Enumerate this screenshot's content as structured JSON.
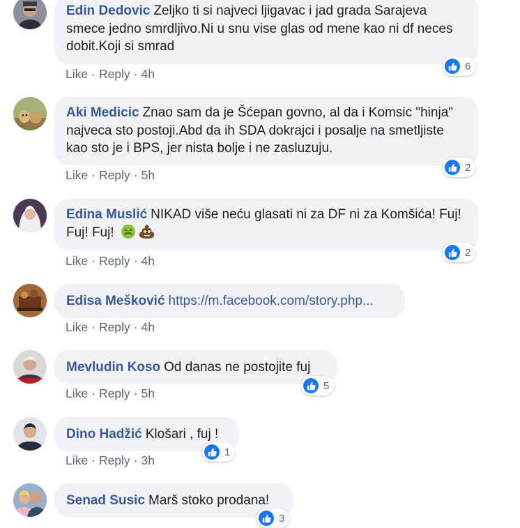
{
  "actions": {
    "like": "Like",
    "reply": "Reply"
  },
  "comments": [
    {
      "author": "Edin Dedovic",
      "text": "Zeljko ti si najveci ljigavac i jad grada Sarajeva smece jedno smrdljivo.Ni u snu vise glas od mene kao ni df neces dobit.Koji si smrad",
      "time": "4h",
      "likes": "6"
    },
    {
      "author": "Aki Medicic",
      "text": "Znao sam da je Šćepan govno, al da i Komsic \"hinja\" najveca sto postoji.Abd da ih SDA dokrajci i posalje na smetljiste kao sto je i BPS, jer nista bolje i ne zasluzuju.",
      "time": "5h",
      "likes": "2"
    },
    {
      "author": "Edina Muslić",
      "text": "NIKAD više neću glasati ni za DF ni za Komšića! Fuj! Fuj! Fuj!",
      "emojis": [
        "nauseated-face-icon",
        "poop-icon"
      ],
      "time": "4h",
      "likes": "2"
    },
    {
      "author": "Edisa Mešković",
      "link": "https://m.facebook.com/story.php...",
      "time": "4h"
    },
    {
      "author": "Mevludin Koso",
      "text": "Od danas ne postojite fuj",
      "time": "5h",
      "likes": "5"
    },
    {
      "author": "Dino Hadžić",
      "text": "Klošari , fuj !",
      "time": "3h",
      "likes": "1"
    },
    {
      "author": "Senad Susic",
      "text": "Marš stoko prodana!",
      "likes": "3"
    }
  ],
  "colors": {
    "author": "#385898",
    "like_blue": "#1877f2",
    "bubble": "#f0f2f5",
    "meta": "#606770"
  }
}
